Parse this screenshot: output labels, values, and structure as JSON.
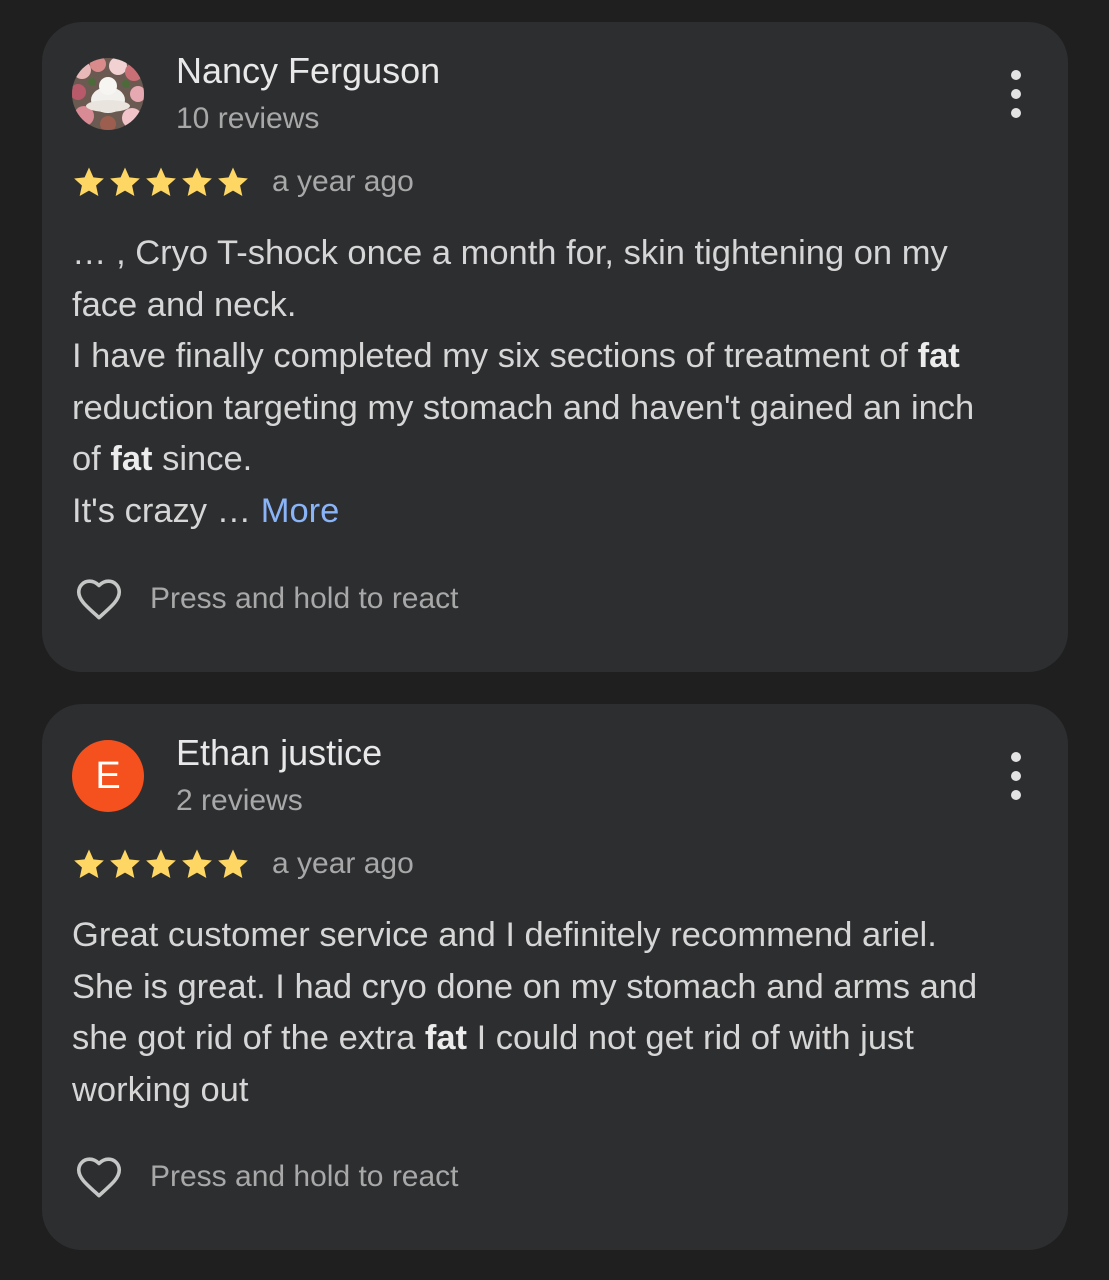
{
  "colors": {
    "background": "#1f1f1f",
    "card": "#2d2e30",
    "star": "#fdd663",
    "link": "#8ab4f8",
    "avatar_ethan": "#f4511e"
  },
  "reviews": [
    {
      "author": "Nancy Ferguson",
      "review_count": "10 reviews",
      "rating": 5,
      "time_ago": "a year ago",
      "avatar": {
        "type": "photo"
      },
      "text": {
        "l1": "… , Cryo T-shock once a month for, skin tightening on my",
        "l2": "face and neck.",
        "l3a": "I have finally completed my six sections of treatment of ",
        "l3b": "fat",
        "l4": "reduction targeting my stomach and haven't gained an inch",
        "l5a": "of ",
        "l5b": "fat",
        "l5c": " since.",
        "l6": "It's crazy … ",
        "more": "More"
      },
      "react_label": "Press and hold to react"
    },
    {
      "author": "Ethan justice",
      "review_count": "2 reviews",
      "rating": 5,
      "time_ago": "a year ago",
      "avatar": {
        "type": "letter",
        "letter": "E"
      },
      "text": {
        "l1": "Great customer service and I definitely recommend ariel.",
        "l2": "She is great. I had cryo done on my stomach and arms and",
        "l3a": "she got rid of the extra ",
        "l3b": "fat",
        "l3c": " I could not get rid of with just",
        "l4": "working out"
      },
      "react_label": "Press and hold to react"
    }
  ]
}
